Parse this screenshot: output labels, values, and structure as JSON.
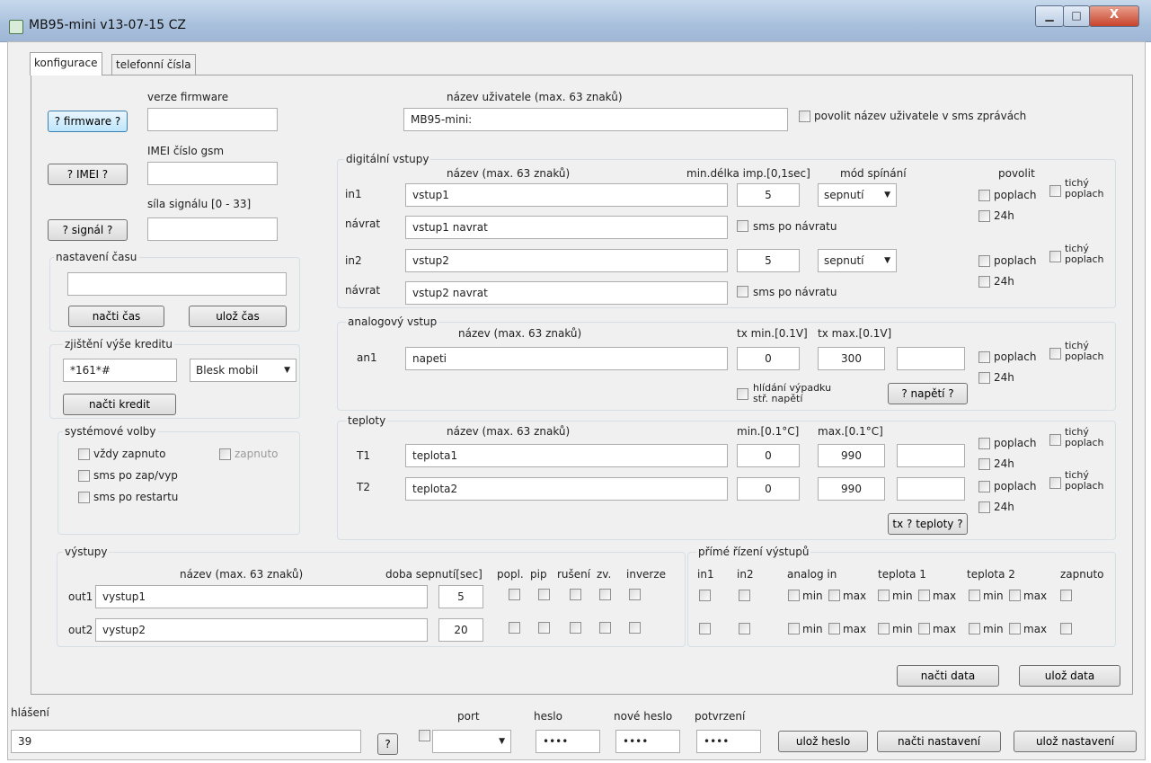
{
  "window": {
    "title": "MB95-mini v13-07-15 CZ",
    "close_symbol": "X"
  },
  "tabs": [
    {
      "label": "konfigurace"
    },
    {
      "label": "telefonní čísla"
    }
  ],
  "device": {
    "firmware_label": "verze firmware",
    "firmware_button": "? firmware ?",
    "firmware_value": "",
    "imei_label": "IMEI číslo gsm",
    "imei_button": "? IMEI ?",
    "imei_value": "",
    "signal_label": "síla signálu [0 - 33]",
    "signal_button": "? signál ?",
    "signal_value": ""
  },
  "user_name": {
    "label": "název uživatele (max. 63 znaků)",
    "value": "MB95-mini:",
    "allow_label": "povolit název uživatele v sms zprávách"
  },
  "time_settings": {
    "title": "nastavení času",
    "value": "",
    "read_button": "načti čas",
    "save_button": "ulož čas"
  },
  "credit": {
    "title": "zjištění výše kreditu",
    "code_value": "*161*#",
    "operator_value": "Blesk mobil",
    "read_button": "načti kredit"
  },
  "system": {
    "title": "systémové volby",
    "always_on": "vždy zapnuto",
    "on": "zapnuto",
    "sms_on_off": "sms po zap/vyp",
    "sms_restart": "sms po restartu"
  },
  "digital_inputs": {
    "title": "digitální vstupy",
    "name_header": "název (max. 63 znaků)",
    "min_len_header": "min.délka imp.[0,1sec]",
    "mode_header": "mód spínání",
    "enable_header": "povolit",
    "rows": [
      {
        "label": "in1",
        "name": "vstup1",
        "min_len": "5",
        "mode": "sepnutí",
        "return_label": "návrat",
        "return_name": "vstup1 navrat"
      },
      {
        "label": "in2",
        "name": "vstup2",
        "min_len": "5",
        "mode": "sepnutí",
        "return_label": "návrat",
        "return_name": "vstup2 navrat"
      }
    ],
    "sms_return": "sms po návratu"
  },
  "alarm": {
    "poplach": "poplach",
    "tichy": "tichý",
    "tichy2": "poplach",
    "h24": "24h"
  },
  "analog": {
    "title": "analogový vstup",
    "name_header": "název (max. 63 znaků)",
    "tx_min_header": "tx min.[0.1V]",
    "tx_max_header": "tx max.[0.1V]",
    "label": "an1",
    "name": "napeti",
    "tx_min": "0",
    "tx_max": "300",
    "value": "",
    "outage_1": "hlídání výpadku",
    "outage_2": "stř. napětí",
    "voltage_button": "? napětí ?"
  },
  "temps": {
    "title": "teploty",
    "name_header": "název (max. 63 znaků)",
    "min_header": "min.[0.1°C]",
    "max_header": "max.[0.1°C]",
    "rows": [
      {
        "label": "T1",
        "name": "teplota1",
        "min": "0",
        "max": "990",
        "value": ""
      },
      {
        "label": "T2",
        "name": "teplota2",
        "min": "0",
        "max": "990",
        "value": ""
      }
    ],
    "button": "tx ? teploty ?"
  },
  "outputs": {
    "title": "výstupy",
    "name_header": "název (max. 63 znaků)",
    "duration_header": "doba sepnutí[sec]",
    "popl": "popl.",
    "pip": "pip",
    "ruseni": "rušení",
    "zv": "zv.",
    "inverze": "inverze",
    "rows": [
      {
        "label": "out1",
        "name": "vystup1",
        "duration": "5"
      },
      {
        "label": "out2",
        "name": "vystup2",
        "duration": "20"
      }
    ]
  },
  "direct": {
    "title": "přímé řízení výstupů",
    "in1": "in1",
    "in2": "in2",
    "analog": "analog in",
    "t1": "teplota 1",
    "t2": "teplota 2",
    "zapnuto": "zapnuto",
    "min": "min",
    "max": "max"
  },
  "data_buttons": {
    "read": "načti data",
    "save": "ulož data"
  },
  "footer": {
    "report_label": "hlášení",
    "report_value": "39",
    "q_button": "?",
    "port_label": "port",
    "port_value": "",
    "pwd_label": "heslo",
    "pwd_value": "••••",
    "new_pwd_label": "nové heslo",
    "new_pwd_value": "••••",
    "confirm_label": "potvrzení",
    "confirm_value": "••••",
    "save_pwd": "ulož heslo",
    "read_settings": "načti nastavení",
    "save_settings": "ulož nastavení"
  }
}
